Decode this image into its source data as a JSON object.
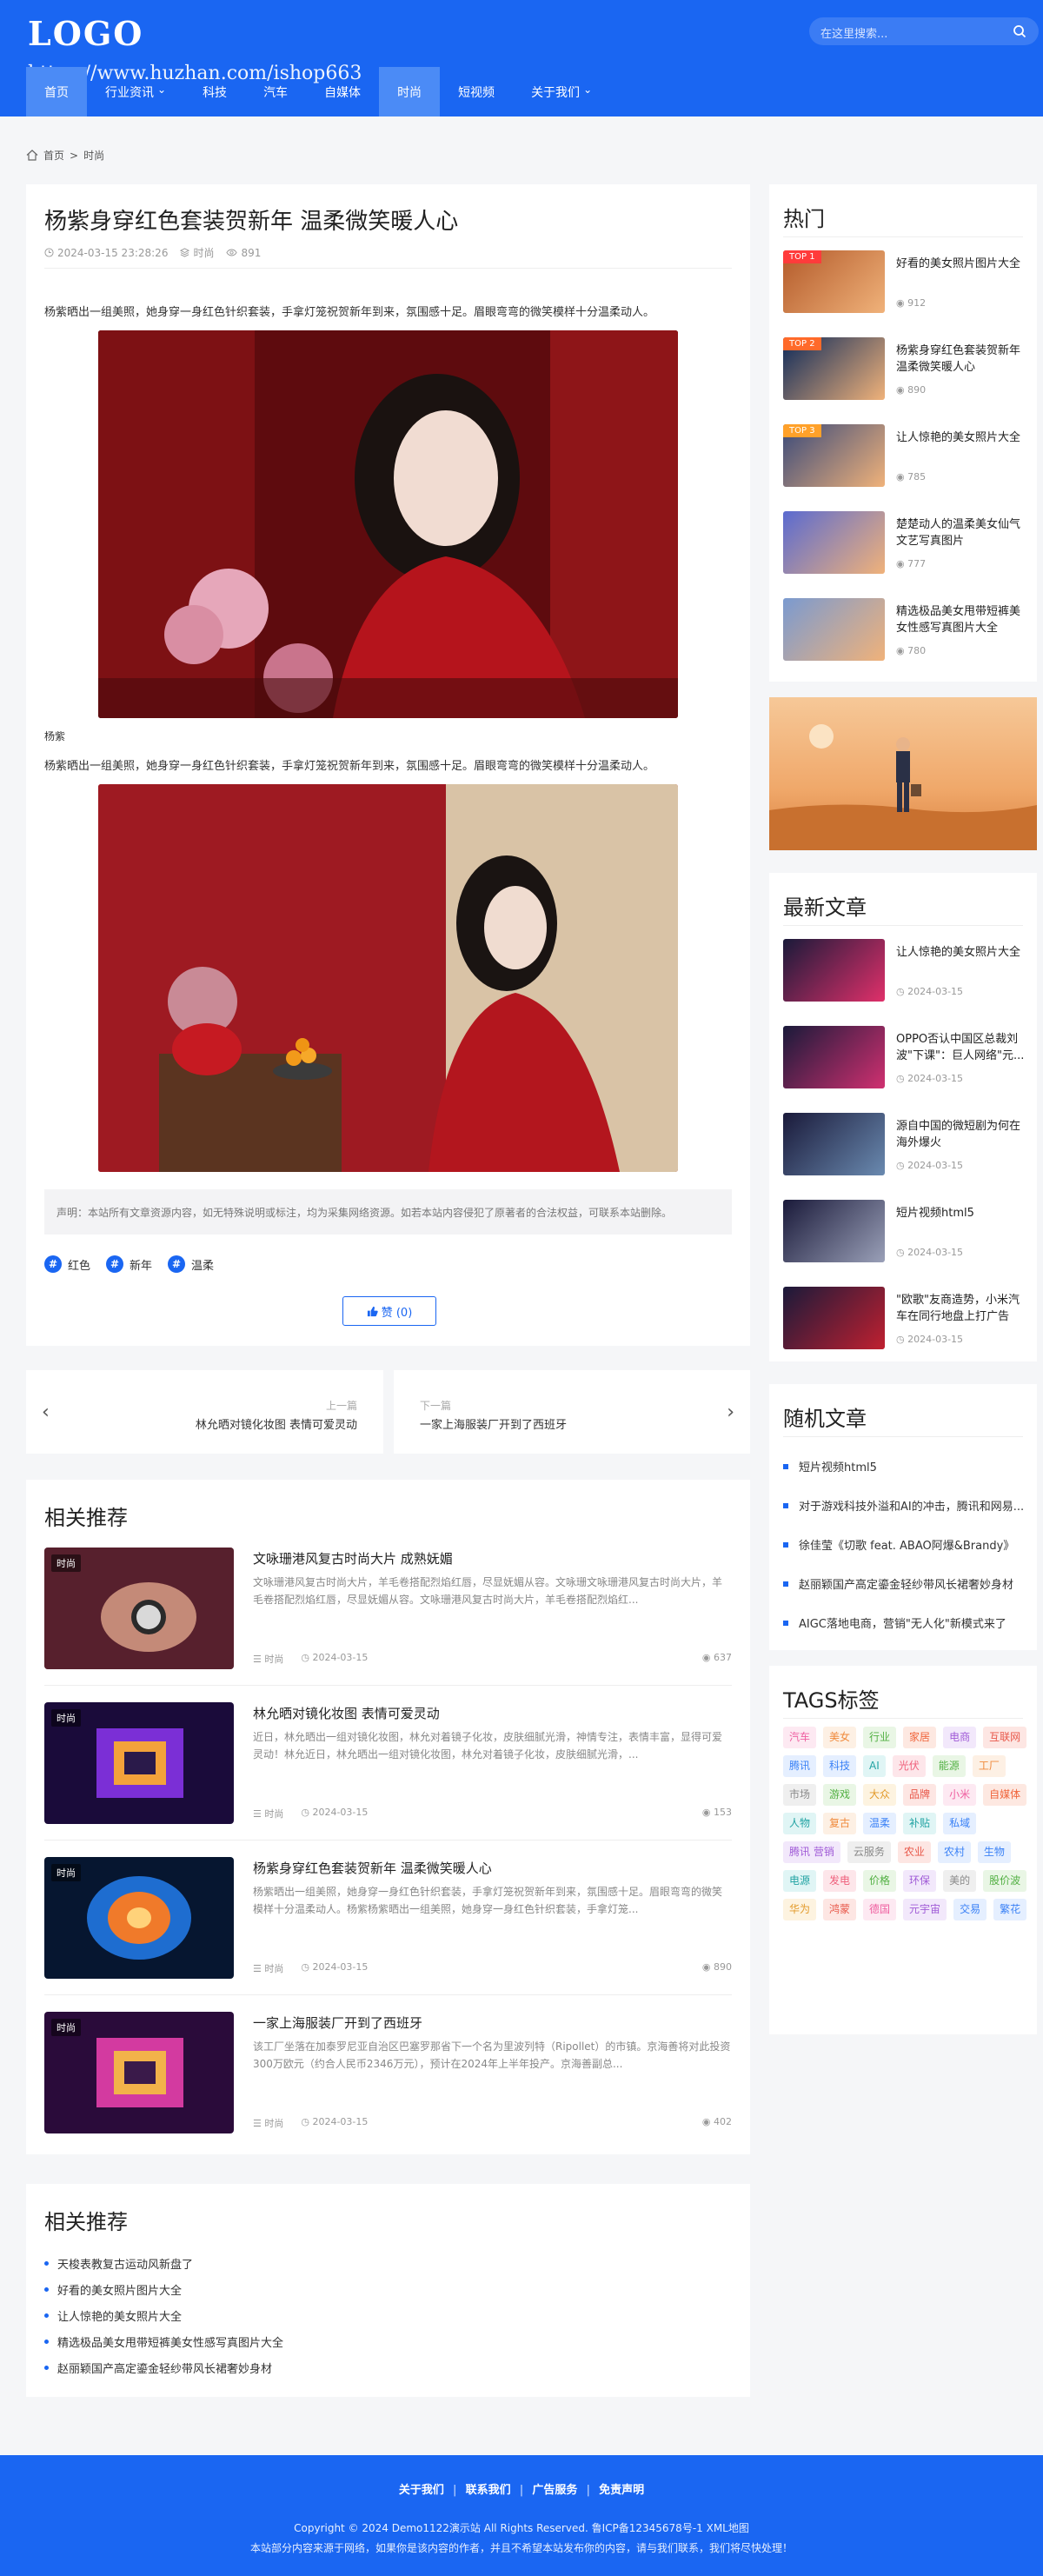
{
  "header": {
    "logo": "LOGO",
    "watermark": "https://www.huzhan.com/ishop663",
    "search_placeholder": "在这里搜索...",
    "nav": [
      {
        "label": "首页",
        "active": false
      },
      {
        "label": "行业资讯",
        "dropdown": true
      },
      {
        "label": "科技"
      },
      {
        "label": "汽车"
      },
      {
        "label": "自媒体"
      },
      {
        "label": "时尚",
        "active": true
      },
      {
        "label": "短视频"
      },
      {
        "label": "关于我们",
        "dropdown": true
      }
    ]
  },
  "breadcrumb": {
    "home": "首页",
    "sep": ">",
    "current": "时尚"
  },
  "article": {
    "title": "杨紫身穿红色套装贺新年 温柔微笑暖人心",
    "date": "2024-03-15 23:28:26",
    "category": "时尚",
    "views": "891",
    "para1": "杨紫晒出一组美照，她身穿一身红色针织套装，手拿灯笼祝贺新年到来，氛围感十足。眉眼弯弯的微笑模样十分温柔动人。",
    "caption": "杨紫",
    "para2": "杨紫晒出一组美照，她身穿一身红色针织套装，手拿灯笼祝贺新年到来，氛围感十足。眉眼弯弯的微笑模样十分温柔动人。",
    "declaration": "声明：本站所有文章资源内容，如无特殊说明或标注，均为采集网络资源。如若本站内容侵犯了原著者的合法权益，可联系本站删除。",
    "tags": [
      "红色",
      "新年",
      "温柔"
    ],
    "like_label": "赞 (0)"
  },
  "prev": {
    "label": "上一篇",
    "title": "林允晒对镜化妆图 表情可爱灵动"
  },
  "next": {
    "label": "下一篇",
    "title": "一家上海服装厂开到了西班牙"
  },
  "related": {
    "heading": "相关推荐",
    "items": [
      {
        "badge": "时尚",
        "title": "文咏珊港风复古时尚大片 成熟妩媚",
        "desc": "文咏珊港风复古时尚大片，羊毛卷搭配烈焰红唇，尽显妩媚从容。文咏珊文咏珊港风复古时尚大片，羊毛卷搭配烈焰红唇，尽显妩媚从容。文咏珊港风复古时尚大片，羊毛卷搭配烈焰红...",
        "cat": "时尚",
        "date": "2024-03-15",
        "views": "637"
      },
      {
        "badge": "时尚",
        "title": "林允晒对镜化妆图 表情可爱灵动",
        "desc": "近日，林允晒出一组对镜化妆图，林允对着镜子化妆，皮肤细腻光滑，神情专注，表情丰富，显得可爱灵动！林允近日，林允晒出一组对镜化妆图，林允对着镜子化妆，皮肤细腻光滑，...",
        "cat": "时尚",
        "date": "2024-03-15",
        "views": "153"
      },
      {
        "badge": "时尚",
        "title": "杨紫身穿红色套装贺新年 温柔微笑暖人心",
        "desc": "杨紫晒出一组美照，她身穿一身红色针织套装，手拿灯笼祝贺新年到来，氛围感十足。眉眼弯弯的微笑模样十分温柔动人。杨紫杨紫晒出一组美照，她身穿一身红色针织套装，手拿灯笼...",
        "cat": "时尚",
        "date": "2024-03-15",
        "views": "890"
      },
      {
        "badge": "时尚",
        "title": "一家上海服装厂开到了西班牙",
        "desc": "该工厂坐落在加泰罗尼亚自治区巴塞罗那省下一个名为里波列特（Ripollet）的市镇。京海善将对此投资300万欧元（约合人民币2346万元），预计在2024年上半年投产。京海善副总...",
        "cat": "时尚",
        "date": "2024-03-15",
        "views": "402"
      }
    ]
  },
  "related2": {
    "heading": "相关推荐",
    "items": [
      "天梭表教复古运动风新盘了",
      "好看的美女照片图片大全",
      "让人惊艳的美女照片大全",
      "精选极品美女甩带短裤美女性感写真图片大全",
      "赵丽颖国产高定鎏金轻纱带风长裙奢妙身材"
    ]
  },
  "hot": {
    "heading": "热门",
    "items": [
      {
        "rank": "TOP 1",
        "rank_color": "#ff3b3b",
        "title": "好看的美女照片图片大全",
        "views": "912"
      },
      {
        "rank": "TOP 2",
        "rank_color": "#ff6a2a",
        "title": "杨紫身穿红色套装贺新年 温柔微笑暖人心",
        "views": "890"
      },
      {
        "rank": "TOP 3",
        "rank_color": "#ffa12a",
        "title": "让人惊艳的美女照片大全",
        "views": "785"
      },
      {
        "rank": "",
        "title": "楚楚动人的温柔美女仙气文艺写真图片",
        "views": "777"
      },
      {
        "rank": "",
        "title": "精选极品美女甩带短裤美女性感写真图片大全",
        "views": "780"
      }
    ]
  },
  "latest": {
    "heading": "最新文章",
    "items": [
      {
        "title": "让人惊艳的美女照片大全",
        "date": "2024-03-15"
      },
      {
        "title": "OPPO否认中国区总裁刘波\"下课\"：巨人网络\"元...",
        "date": "2024-03-15"
      },
      {
        "title": "源自中国的微短剧为何在海外爆火",
        "date": "2024-03-15"
      },
      {
        "title": "短片视频html5",
        "date": "2024-03-15"
      },
      {
        "title": "\"欧歌\"友商造势，小米汽车在同行地盘上打广告",
        "date": "2024-03-15"
      }
    ]
  },
  "random": {
    "heading": "随机文章",
    "items": [
      "短片视频html5",
      "对于游戏科技外溢和AI的冲击，腾讯和网易...",
      "徐佳莹《切歌 feat. ABAO阿爆&Brandy》",
      "赵丽颖国产高定鎏金轻纱带风长裙奢妙身材",
      "AIGC落地电商，营销\"无人化\"新模式来了"
    ]
  },
  "tags": {
    "heading": "TAGS标签",
    "items": [
      {
        "t": "汽车",
        "c": "#ef5fa0",
        "b": "#fde9f2"
      },
      {
        "t": "美女",
        "c": "#f08a3c",
        "b": "#fdf0e4"
      },
      {
        "t": "行业",
        "c": "#52b043",
        "b": "#e9f6e5"
      },
      {
        "t": "家居",
        "c": "#f0653c",
        "b": "#fde8e1"
      },
      {
        "t": "电商",
        "c": "#a05bd7",
        "b": "#f2e8fb"
      },
      {
        "t": "互联网",
        "c": "#e8584a",
        "b": "#fde6e3"
      },
      {
        "t": "腾讯",
        "c": "#3b82f6",
        "b": "#e5efff"
      },
      {
        "t": "科技",
        "c": "#3b82f6",
        "b": "#e5efff"
      },
      {
        "t": "AI",
        "c": "#22a3a3",
        "b": "#e0f5f5"
      },
      {
        "t": "光伏",
        "c": "#ef5f7b",
        "b": "#fde6ea"
      },
      {
        "t": "能源",
        "c": "#52b043",
        "b": "#e9f6e5"
      },
      {
        "t": "工厂",
        "c": "#f08a3c",
        "b": "#fdf0e4"
      },
      {
        "t": "市场",
        "c": "#8a8a8a",
        "b": "#efefef"
      },
      {
        "t": "游戏",
        "c": "#52b043",
        "b": "#e9f6e5"
      },
      {
        "t": "大众",
        "c": "#e29a2a",
        "b": "#fdf3e0"
      },
      {
        "t": "品牌",
        "c": "#e8584a",
        "b": "#fde6e3"
      },
      {
        "t": "小米",
        "c": "#ef5fa0",
        "b": "#fde9f2"
      },
      {
        "t": "自媒体",
        "c": "#f0653c",
        "b": "#fde8e1"
      },
      {
        "t": "人物",
        "c": "#22a3a3",
        "b": "#e0f5f5"
      },
      {
        "t": "复古",
        "c": "#f08a3c",
        "b": "#fdf0e4"
      },
      {
        "t": "温柔",
        "c": "#3b82f6",
        "b": "#e5efff"
      },
      {
        "t": "补贴",
        "c": "#22a3a3",
        "b": "#e0f5f5"
      },
      {
        "t": "私域",
        "c": "#3b82f6",
        "b": "#e5efff"
      },
      {
        "t": "腾讯 营销",
        "c": "#a05bd7",
        "b": "#f2e8fb"
      },
      {
        "t": "云服务",
        "c": "#8a8a8a",
        "b": "#efefef"
      },
      {
        "t": "农业",
        "c": "#e8584a",
        "b": "#fde6e3"
      },
      {
        "t": "农村",
        "c": "#3b82f6",
        "b": "#e5efff"
      },
      {
        "t": "生物",
        "c": "#3b82f6",
        "b": "#e5efff"
      },
      {
        "t": "电源",
        "c": "#22a3a3",
        "b": "#e0f5f5"
      },
      {
        "t": "发电",
        "c": "#ef5f7b",
        "b": "#fde6ea"
      },
      {
        "t": "价格",
        "c": "#52b043",
        "b": "#e9f6e5"
      },
      {
        "t": "环保",
        "c": "#a05bd7",
        "b": "#f2e8fb"
      },
      {
        "t": "美的",
        "c": "#8a8a8a",
        "b": "#efefef"
      },
      {
        "t": "股价波",
        "c": "#52b043",
        "b": "#e9f6e5"
      },
      {
        "t": "华为",
        "c": "#e29a2a",
        "b": "#fdf3e0"
      },
      {
        "t": "鸿蒙",
        "c": "#e8584a",
        "b": "#fde6e3"
      },
      {
        "t": "德国",
        "c": "#ef5fa0",
        "b": "#fde9f2"
      },
      {
        "t": "元宇宙",
        "c": "#a05bd7",
        "b": "#f2e8fb"
      },
      {
        "t": "交易",
        "c": "#3b82f6",
        "b": "#e5efff"
      },
      {
        "t": "繁花",
        "c": "#3b82f6",
        "b": "#e5efff"
      }
    ]
  },
  "footer": {
    "links": [
      "关于我们",
      "联系我们",
      "广告服务",
      "免责声明"
    ],
    "copyright": "Copyright © 2024 Demo1122演示站 All Rights Reserved. 鲁ICP备12345678号-1 XML地图",
    "note": "本站部分内容来源于网络，如果你是该内容的作者，并且不希望本站发布你的内容，请与我们联系，我们将尽快处理！"
  }
}
